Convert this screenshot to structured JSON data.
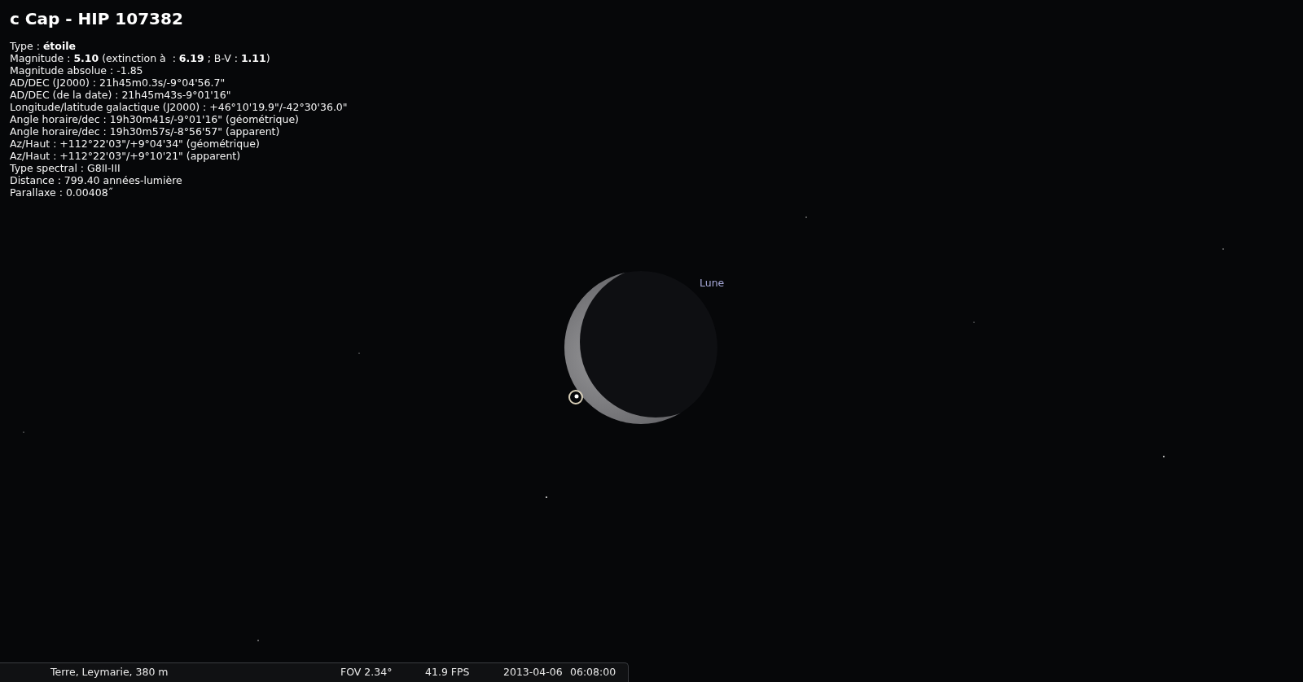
{
  "object_info": {
    "title": "c Cap - HIP 107382",
    "lines": [
      "Type : **étoile**",
      "Magnitude : **5.10** (extinction à  : **6.19** ; B-V : **1.11**)",
      "Magnitude absolue : -1.85",
      "AD/DEC (J2000) : 21h45m0.3s/-9°04'56.7\"",
      "AD/DEC (de la date) : 21h45m43s-9°01'16\"",
      "Longitude/latitude galactique (J2000) : +46°10'19.9\"/-42°30'36.0\"",
      "Angle horaire/dec : 19h30m41s/-9°01'16\" (géométrique)",
      "Angle horaire/dec : 19h30m57s/-8°56'57\" (apparent)",
      "Az/Haut : +112°22'03\"/+9°04'34\" (géométrique)",
      "Az/Haut : +112°22'03\"/+9°10'21\" (apparent)",
      "Type spectral : G8II-III",
      "Distance : 799.40 années-lumière",
      "Parallaxe : 0.00408˝"
    ]
  },
  "sky": {
    "moon_label": "Lune"
  },
  "status_bar": {
    "location": "Terre, Leymarie, 380 m",
    "fov": "FOV 2.34°",
    "fps": "41.9 FPS",
    "date": "2013-04-06",
    "time": "06:08:00"
  }
}
